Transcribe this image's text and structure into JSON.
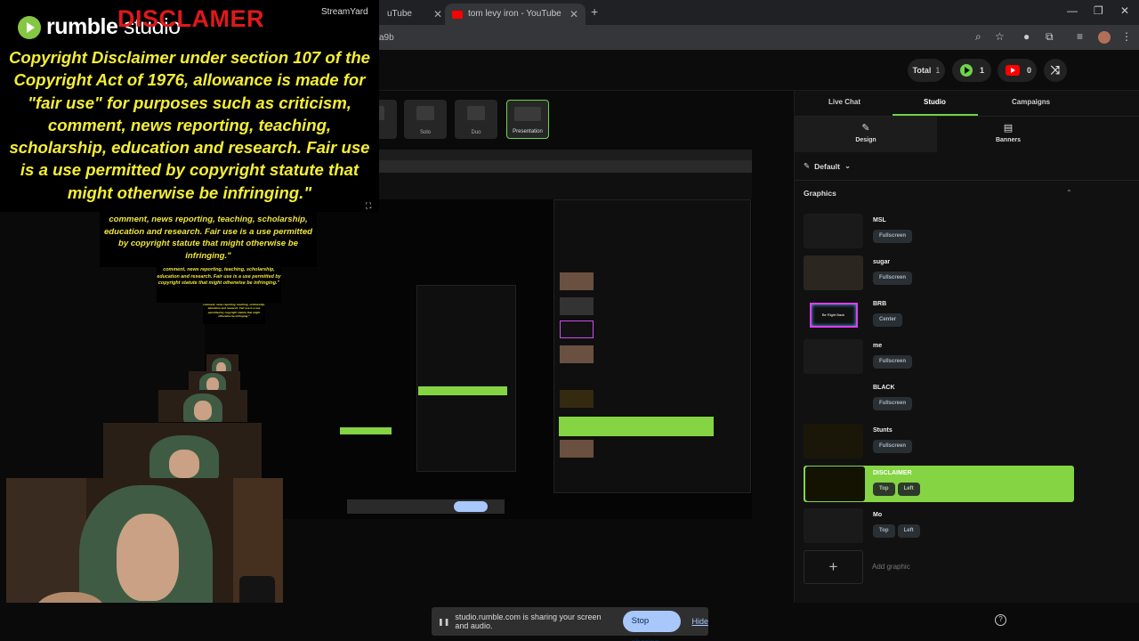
{
  "browser": {
    "tabs": [
      {
        "title": "uTube"
      },
      {
        "title": "tom levy iron - YouTube"
      }
    ],
    "url_fragment": "a9b"
  },
  "overlay": {
    "brand": "rumble",
    "brand_suffix": "studio",
    "title": "DISCLAMER",
    "streamyard": "StreamYard",
    "body": "Copyright Disclaimer under section 107 of the Copyright Act of 1976, allowance is made for \"fair use\" for purposes such as criticism, comment, news reporting, teaching, scholarship, education and research. Fair use is a use permitted by copyright statute that might otherwise be infringing.\"",
    "echo1": "comment, news reporting, teaching, scholarship, education and research. Fair use is a use permitted by copyright statute that might otherwise be infringing.\"",
    "echo2": "comment, news reporting, teaching, scholarship, education and research. Fair use is a use permitted by copyright statute that might otherwise be infringing.\"",
    "echo3": "comment, news reporting, teaching, scholarship, education and research. Fair use is a use permitted by copyright statute that might otherwise be infringing.\""
  },
  "header": {
    "total_label": "Total",
    "total_count": "1",
    "rumble_count": "1",
    "youtube_count": "0"
  },
  "layouts": [
    {
      "label": "Solo"
    },
    {
      "label": "Duo"
    },
    {
      "label": "Presentation"
    }
  ],
  "panel": {
    "tabs": {
      "live_chat": "Live Chat",
      "studio": "Studio",
      "campaigns": "Campaigns"
    },
    "subtabs": {
      "design": "Design",
      "banners": "Banners"
    },
    "preset": "Default",
    "graphics_heading": "Graphics",
    "graphics": [
      {
        "name": "MSL",
        "options": [
          "Fullscreen"
        ]
      },
      {
        "name": "sugar",
        "options": [
          "Fullscreen"
        ]
      },
      {
        "name": "BRB",
        "options": [
          "Center"
        ],
        "thumb_text": "Be Right Back"
      },
      {
        "name": "me",
        "options": [
          "Fullscreen"
        ]
      },
      {
        "name": "BLACK",
        "options": [
          "Fullscreen"
        ]
      },
      {
        "name": "Stunts",
        "options": [
          "Fullscreen"
        ]
      },
      {
        "name": "DISCLAIMER",
        "options": [
          "Top",
          "Left"
        ]
      },
      {
        "name": "Mo",
        "options": [
          "Top",
          "Left"
        ]
      }
    ],
    "add_graphic": "Add graphic",
    "accent": "#6fd34b",
    "active_graphic_color": "#84d444"
  },
  "share_bar": {
    "notice": "studio.rumble.com is sharing your screen and audio.",
    "stop": "Stop sharing",
    "hide": "Hide"
  }
}
